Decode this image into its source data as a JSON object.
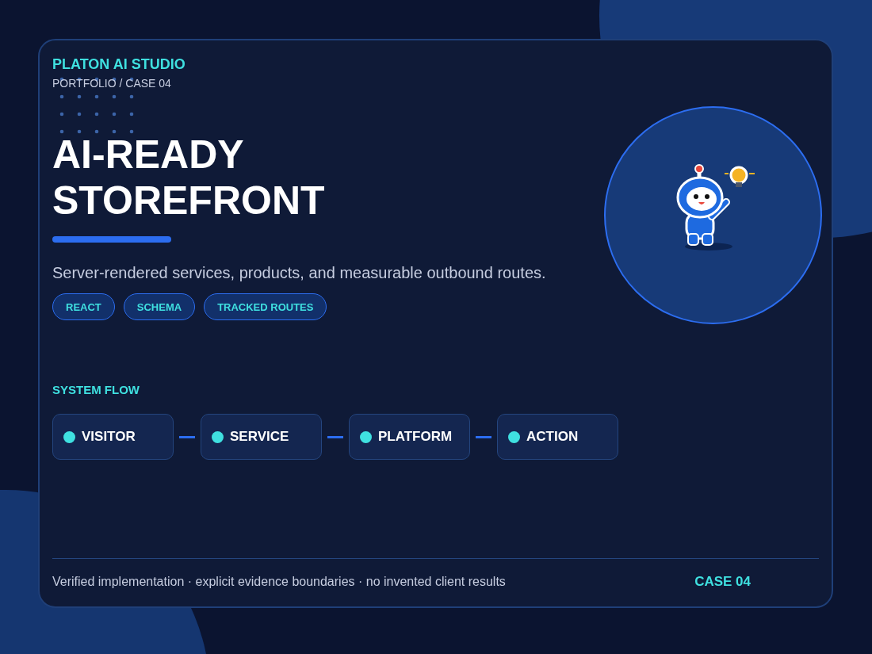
{
  "brand": {
    "name": "PLATON AI STUDIO",
    "breadcrumb": "PORTFOLIO / CASE 04"
  },
  "headline": {
    "lines": [
      "AI-READY",
      "STOREFRONT"
    ]
  },
  "description": "Server-rendered services, products, and measurable outbound routes.",
  "tags": [
    "REACT",
    "SCHEMA",
    "TRACKED ROUTES"
  ],
  "flow": {
    "title": "SYSTEM FLOW",
    "steps": [
      "VISITOR",
      "SERVICE",
      "PLATFORM",
      "ACTION"
    ]
  },
  "footer": {
    "note": "Verified implementation · explicit evidence boundaries · no invented client results",
    "case_label": "CASE 04"
  }
}
